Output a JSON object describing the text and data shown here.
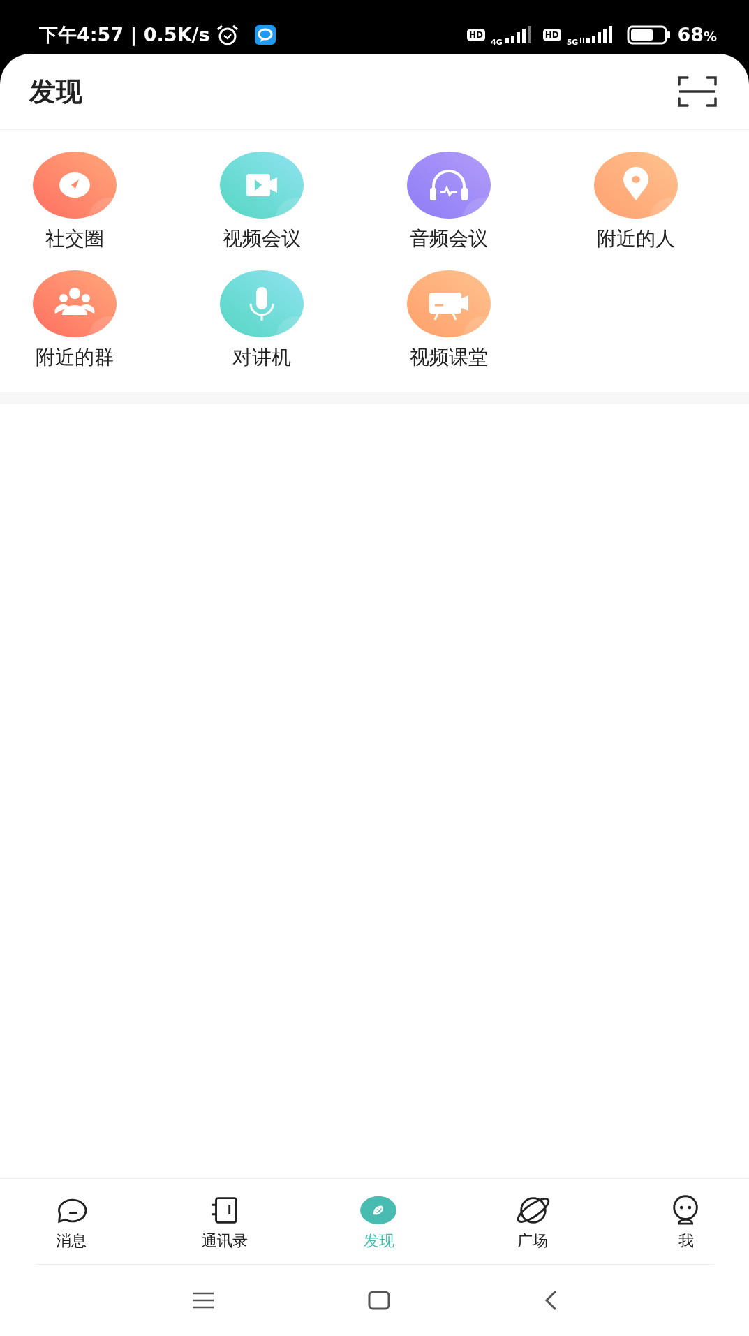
{
  "status_bar": {
    "time": "下午4:57",
    "separator": "|",
    "speed": "0.5K/s",
    "sim1_hd": "HD",
    "sim1_network": "4G",
    "sim2_hd": "HD",
    "sim2_network": "5G",
    "battery": {
      "text": "68",
      "unit": "%",
      "level": 0.68
    }
  },
  "header": {
    "title": "发现"
  },
  "features": [
    {
      "label": "社交圈",
      "kind": "compass"
    },
    {
      "label": "视频会议",
      "kind": "camera"
    },
    {
      "label": "音频会议",
      "kind": "headset"
    },
    {
      "label": "附近的人",
      "kind": "pin"
    },
    {
      "label": "附近的群",
      "kind": "group"
    },
    {
      "label": "对讲机",
      "kind": "mic"
    },
    {
      "label": "视频课堂",
      "kind": "screen"
    }
  ],
  "tabs": [
    {
      "label": "消息",
      "kind": "chat",
      "selected": false
    },
    {
      "label": "通讯录",
      "kind": "book",
      "selected": false
    },
    {
      "label": "发现",
      "kind": "discover",
      "selected": true
    },
    {
      "label": "广场",
      "kind": "planet",
      "selected": false
    },
    {
      "label": "我",
      "kind": "me",
      "selected": false
    }
  ]
}
